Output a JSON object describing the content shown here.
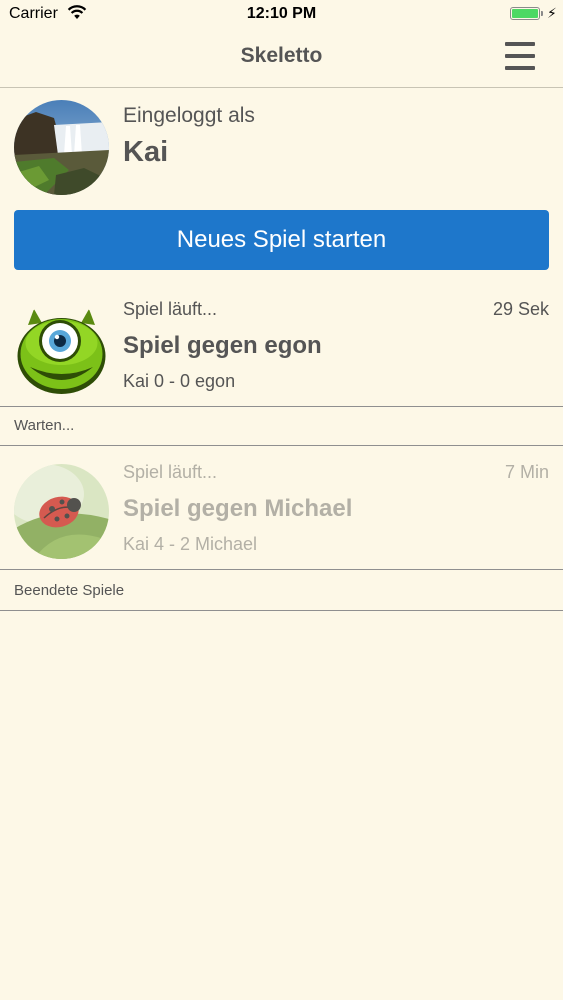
{
  "status_bar": {
    "carrier": "Carrier",
    "time": "12:10 PM",
    "battery_percent": 100,
    "icons": [
      "wifi-icon",
      "battery-icon",
      "charging-bolt-icon"
    ]
  },
  "nav": {
    "title": "Skeletto",
    "menu_icon": "hamburger-menu-icon"
  },
  "profile": {
    "logged_in_label": "Eingeloggt als",
    "username": "Kai"
  },
  "new_game_button": {
    "label": "Neues Spiel starten",
    "color": "#1e77cb"
  },
  "games": [
    {
      "status": "Spiel läuft...",
      "time": "29 Sek",
      "title": "Spiel gegen egon",
      "score": "Kai 0 - 0 egon",
      "avatar_icon": "green-monster-avatar-icon"
    },
    {
      "status": "Spiel läuft...",
      "time": "7 Min",
      "title": "Spiel gegen Michael",
      "score": "Kai 4 - 2 Michael",
      "avatar_icon": "ladybug-avatar-icon"
    }
  ],
  "sections": {
    "waiting": "Warten...",
    "finished": "Beendete Spiele"
  },
  "colors": {
    "background": "#fdf8e7",
    "text": "#555555",
    "text_dimmed": "#b3b0a6"
  }
}
